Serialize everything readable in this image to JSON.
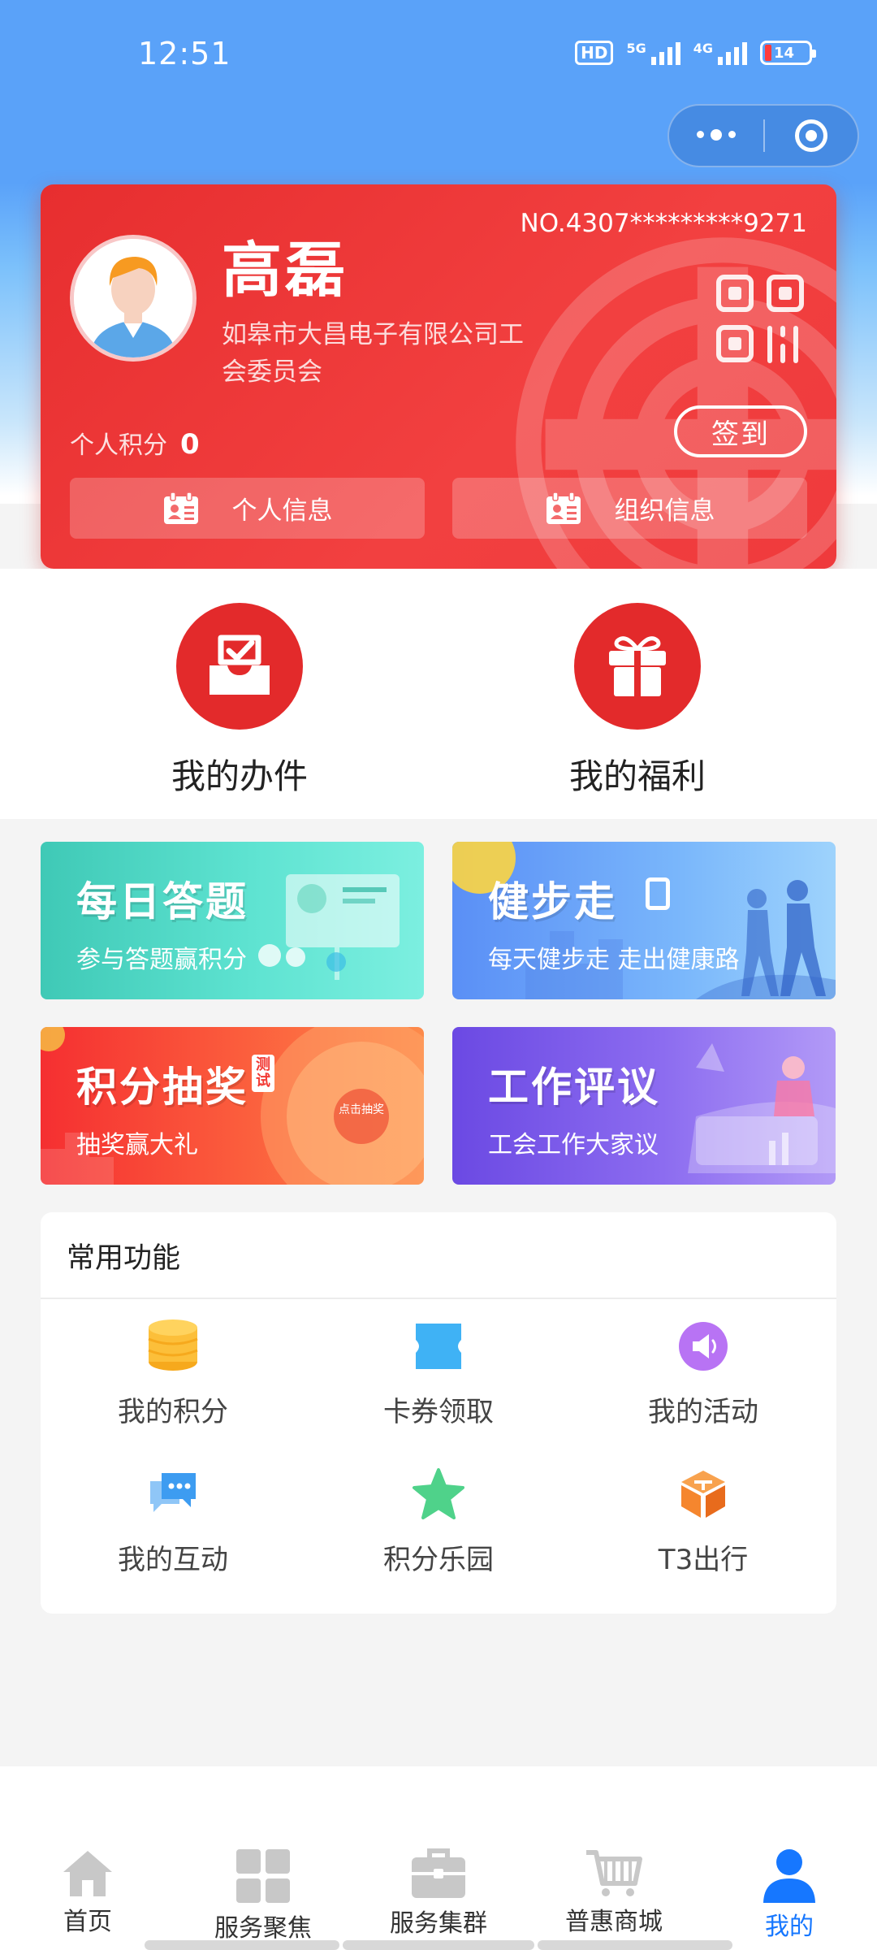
{
  "status_bar": {
    "time": "12:51",
    "hd_label": "HD",
    "network_1": "5G",
    "network_2": "4G",
    "battery": "14"
  },
  "capsule": {
    "more_icon": "more-dots-icon",
    "close_icon": "target-icon"
  },
  "card": {
    "name": "高磊",
    "member_no": "NO.4307*********9271",
    "organization": "如皋市大昌电子有限公司工会委员会",
    "points_label": "个人积分",
    "points_value": "0",
    "checkin_label": "签到",
    "actions": [
      {
        "label": "个人信息",
        "icon": "id-card-icon"
      },
      {
        "label": "组织信息",
        "icon": "id-card-icon"
      }
    ],
    "accent": "#e83132"
  },
  "features": [
    {
      "label": "我的办件",
      "icon": "inbox-check-icon"
    },
    {
      "label": "我的福利",
      "icon": "gift-icon"
    }
  ],
  "banners": [
    {
      "title": "每日答题",
      "subtitle": "参与答题赢积分"
    },
    {
      "title": "健步走",
      "subtitle": "每天健步走  走出健康路"
    },
    {
      "title": "积分抽奖",
      "subtitle": "抽奖赢大礼",
      "tag": "测试",
      "wheel_text": "点击抽奖"
    },
    {
      "title": "工作评议",
      "subtitle": "工会工作大家议"
    }
  ],
  "common": {
    "title": "常用功能",
    "items": [
      {
        "label": "我的积分",
        "icon": "coin-stack-icon",
        "color": "#fcbf3a"
      },
      {
        "label": "卡券领取",
        "icon": "ticket-icon",
        "color": "#3fb2f5"
      },
      {
        "label": "我的活动",
        "icon": "megaphone-icon",
        "color": "#b873f4"
      },
      {
        "label": "我的互动",
        "icon": "chat-bubbles-icon",
        "color": "#3d9cf1"
      },
      {
        "label": "积分乐园",
        "icon": "star-icon",
        "color": "#4fd28a"
      },
      {
        "label": "T3出行",
        "icon": "t3-logo-icon",
        "color": "#f5862e"
      }
    ]
  },
  "tabbar": {
    "tabs": [
      {
        "label": "首页",
        "icon": "home-icon"
      },
      {
        "label": "服务聚焦",
        "icon": "grid-icon"
      },
      {
        "label": "服务集群",
        "icon": "briefcase-icon"
      },
      {
        "label": "普惠商城",
        "icon": "cart-icon"
      },
      {
        "label": "我的",
        "icon": "user-icon",
        "active": true
      }
    ],
    "active_color": "#1677ff"
  }
}
